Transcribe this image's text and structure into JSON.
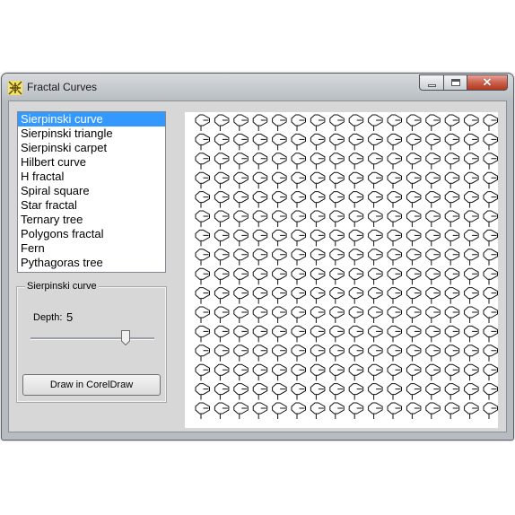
{
  "window": {
    "title": "Fractal Curves"
  },
  "fractal_list": {
    "items": [
      "Sierpinski curve",
      "Sierpinski triangle",
      "Sierpinski carpet",
      "Hilbert curve",
      "H fractal",
      "Spiral square",
      "Star fractal",
      "Ternary tree",
      "Polygons fractal",
      "Fern",
      "Pythagoras tree"
    ],
    "selected_index": 0
  },
  "options": {
    "group_title": "Sierpinski curve",
    "depth_label": "Depth:",
    "depth_value": "5",
    "draw_button": "Draw in CorelDraw"
  },
  "icons": {
    "app": "fractal-app-icon",
    "minimize": "minimize-icon",
    "maximize": "maximize-icon",
    "close": "close-icon"
  }
}
